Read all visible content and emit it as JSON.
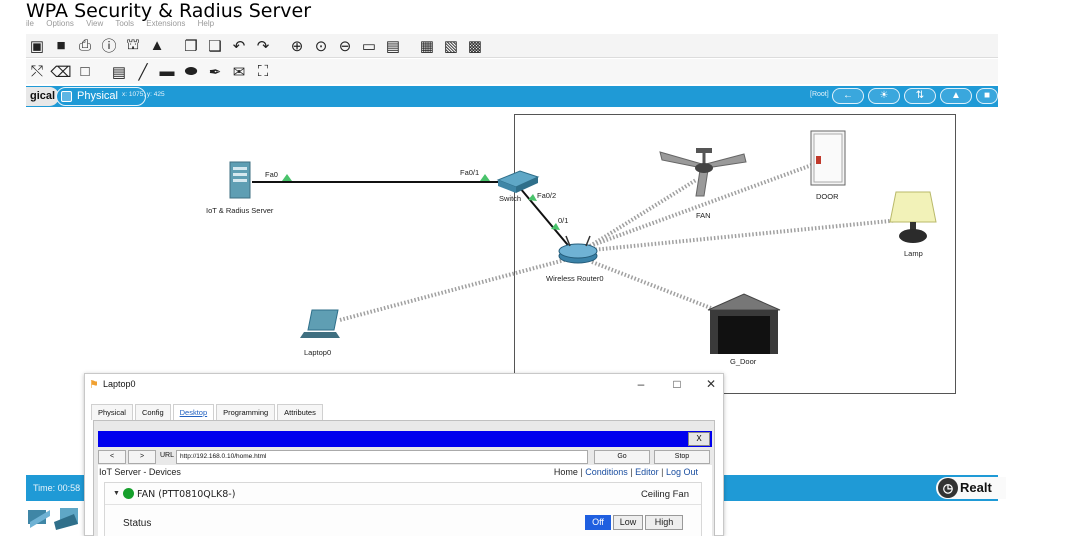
{
  "video_title": "WPA Security & Radius Server",
  "menu": [
    "ile",
    "Options",
    "View",
    "Tools",
    "Extensions",
    "Help"
  ],
  "mode_bar": {
    "logical_tab": "gical",
    "physical_tab": "Physical",
    "coordinates": "x: 1075, y: 425",
    "root_label": "[Root]"
  },
  "topology": {
    "devices": {
      "server": "IoT & Radius Server",
      "switch": "Switch",
      "router": "Wireless Router0",
      "laptop": "Laptop0",
      "fan": "FAN",
      "door": "DOOR",
      "lamp": "Lamp",
      "garage": "G_Door"
    },
    "ports": {
      "server_fa0": "Fa0",
      "switch_fa01": "Fa0/1",
      "switch_fa02": "Fa0/2",
      "router_01": "0/1"
    }
  },
  "status_bar": {
    "time": "Time: 00:58",
    "realtime": "Realt"
  },
  "dialog": {
    "title": "Laptop0",
    "tabs": [
      "Physical",
      "Config",
      "Desktop",
      "Programming",
      "Attributes"
    ],
    "active_tab": "Desktop",
    "browser": {
      "close_label": "X",
      "back_label": "<",
      "forward_label": ">",
      "url_label": "URL",
      "url_value": "http://192.168.0.10/home.html",
      "go_label": "Go",
      "stop_label": "Stop",
      "page": {
        "heading": "IoT Server - Devices",
        "links": [
          "Home",
          "Conditions",
          "Editor",
          "Log Out"
        ],
        "device": {
          "name": "FAN (PTT0810QLK8-)",
          "type": "Ceiling Fan",
          "status_label": "Status",
          "options": [
            "Off",
            "Low",
            "High"
          ],
          "selected": "Off"
        }
      }
    }
  },
  "colors": {
    "accent_blue": "#1f9ad6",
    "link_green": "#49c36b",
    "browser_title_blue": "#0000ee",
    "status_green": "#16a02c"
  }
}
